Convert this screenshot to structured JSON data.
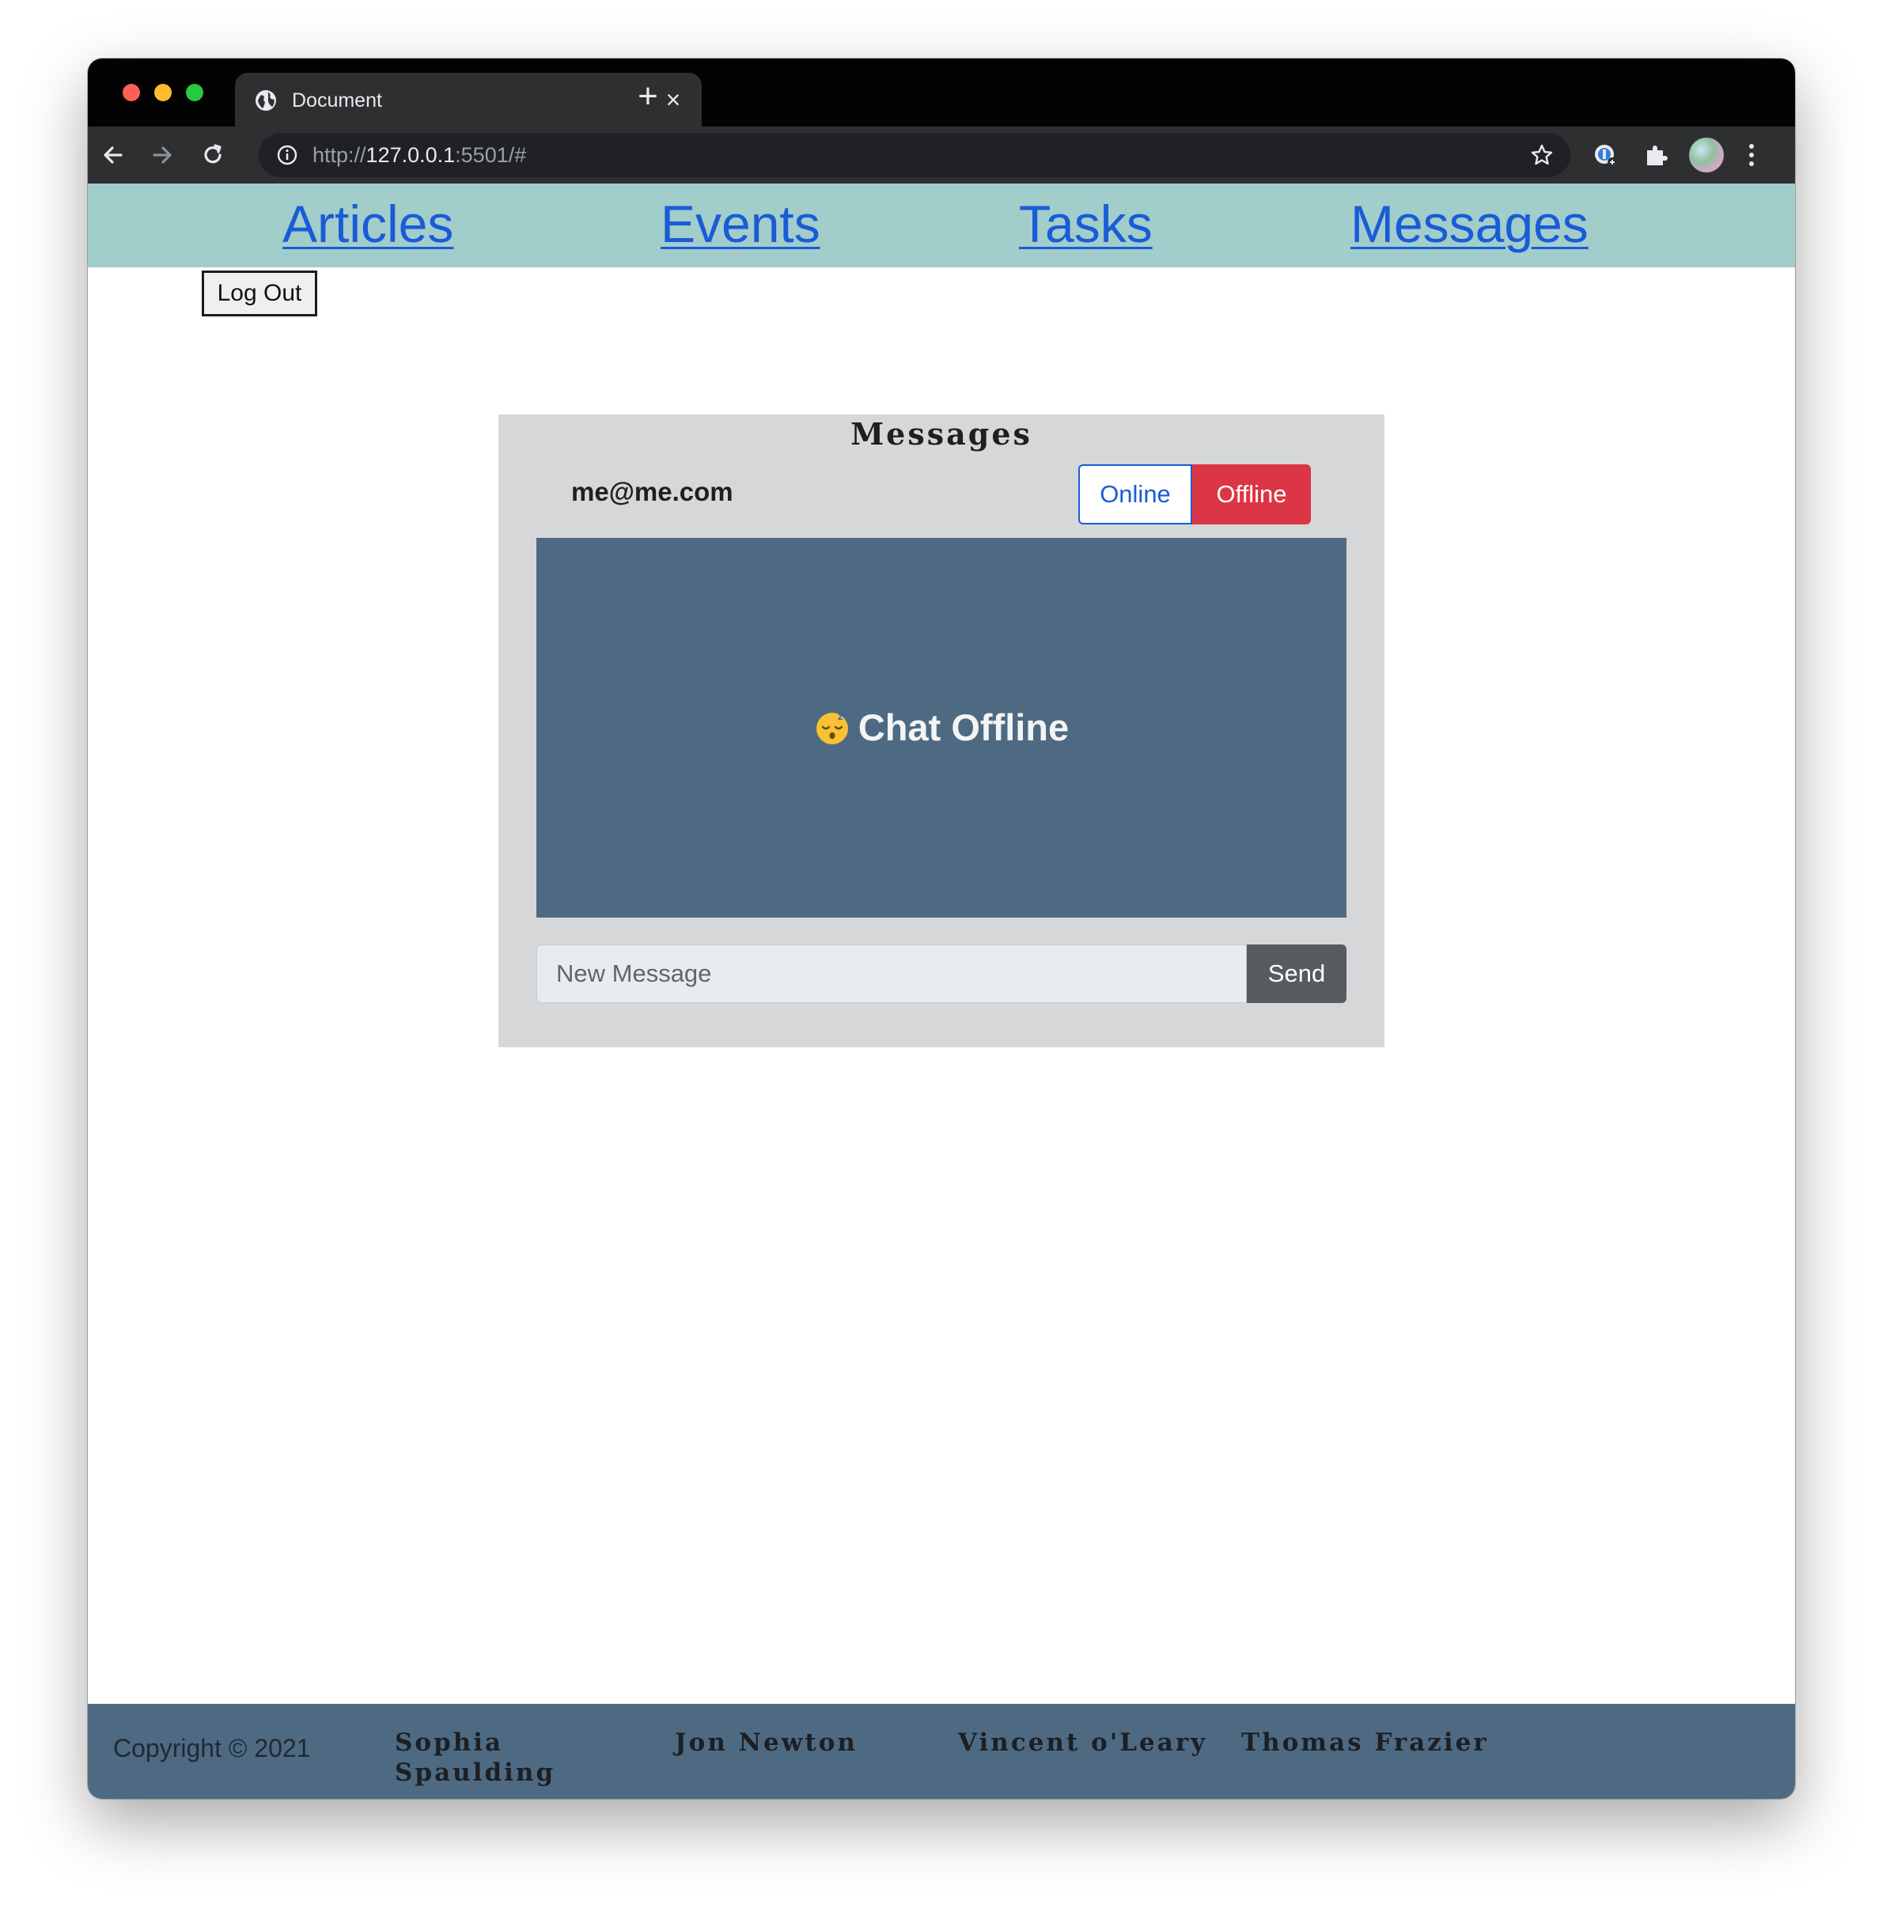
{
  "browser": {
    "tab_title": "Document",
    "url_scheme": "http://",
    "url_host": "127.0.0.1",
    "url_rest": ":5501/#"
  },
  "nav": {
    "items": [
      "Articles",
      "Events",
      "Tasks",
      "Messages"
    ]
  },
  "logout_label": "Log Out",
  "messages": {
    "title": "Messages",
    "user_email": "me@me.com",
    "online_label": "Online",
    "offline_label": "Offline",
    "chat_status": "Chat Offline",
    "input_placeholder": "New Message",
    "send_label": "Send"
  },
  "footer": {
    "copyright": "Copyright © 2021",
    "authors": [
      "Sophia Spaulding",
      "Jon Newton",
      "Vincent o'Leary",
      "Thomas Frazier"
    ]
  },
  "colors": {
    "nav_bg": "#a1cdcb",
    "link": "#1a5bd8",
    "panel_bg": "#d6d7d9",
    "chat_bg": "#4e6a83",
    "offline_red": "#dc3545",
    "send_gray": "#575b60",
    "footer_bg": "#4e6a83"
  }
}
